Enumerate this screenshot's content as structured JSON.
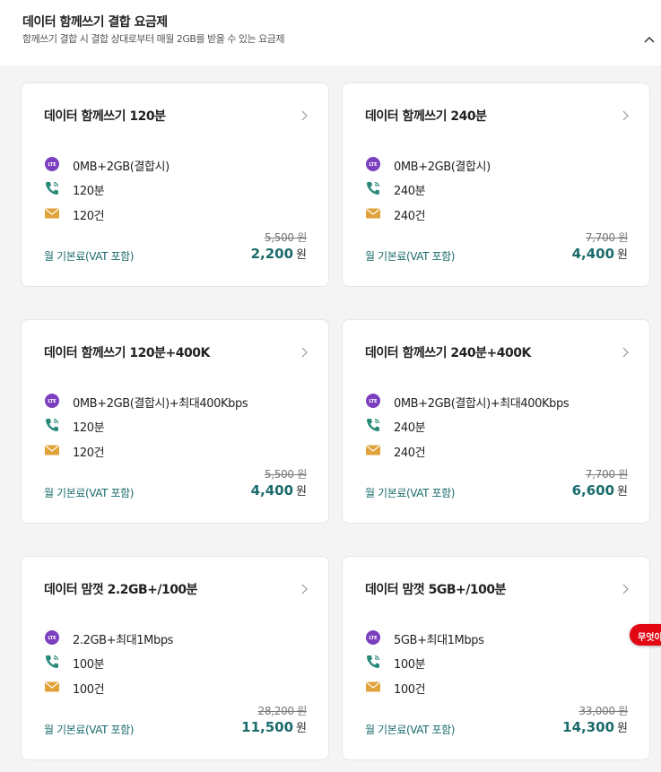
{
  "header": {
    "title": "데이터 함께쓰기 결합 요금제",
    "subtitle": "함께쓰기 결합 시 결합 상대로부터 매월 2GB를 받을 수 있는 요금제"
  },
  "colors": {
    "accent": "#1b6b6b",
    "lte_icon": "#7b3fbf",
    "call_icon": "#2a8a7a",
    "sms_icon": "#e0a23a",
    "badge": "#e30613"
  },
  "fee_label": "월 기본료(VAT 포함)",
  "currency": "원",
  "floating_badge": "무엇이",
  "plans": [
    {
      "name": "데이터 함께쓰기 120분",
      "data": "0MB+2GB(결합시)",
      "voice": "120분",
      "sms": "120건",
      "original_price": "5,500 원",
      "price": "2,200"
    },
    {
      "name": "데이터 함께쓰기 240분",
      "data": "0MB+2GB(결합시)",
      "voice": "240분",
      "sms": "240건",
      "original_price": "7,700 원",
      "price": "4,400"
    },
    {
      "name": "데이터 함께쓰기 120분+400K",
      "data": "0MB+2GB(결합시)+최대400Kbps",
      "voice": "120분",
      "sms": "120건",
      "original_price": "5,500 원",
      "price": "4,400"
    },
    {
      "name": "데이터 함께쓰기 240분+400K",
      "data": "0MB+2GB(결합시)+최대400Kbps",
      "voice": "240분",
      "sms": "240건",
      "original_price": "7,700 원",
      "price": "6,600"
    },
    {
      "name": "데이터 맘껏 2.2GB+/100분",
      "data": "2.2GB+최대1Mbps",
      "voice": "100분",
      "sms": "100건",
      "original_price": "28,200 원",
      "price": "11,500"
    },
    {
      "name": "데이터 맘껏 5GB+/100분",
      "data": "5GB+최대1Mbps",
      "voice": "100분",
      "sms": "100건",
      "original_price": "33,000 원",
      "price": "14,300"
    }
  ]
}
